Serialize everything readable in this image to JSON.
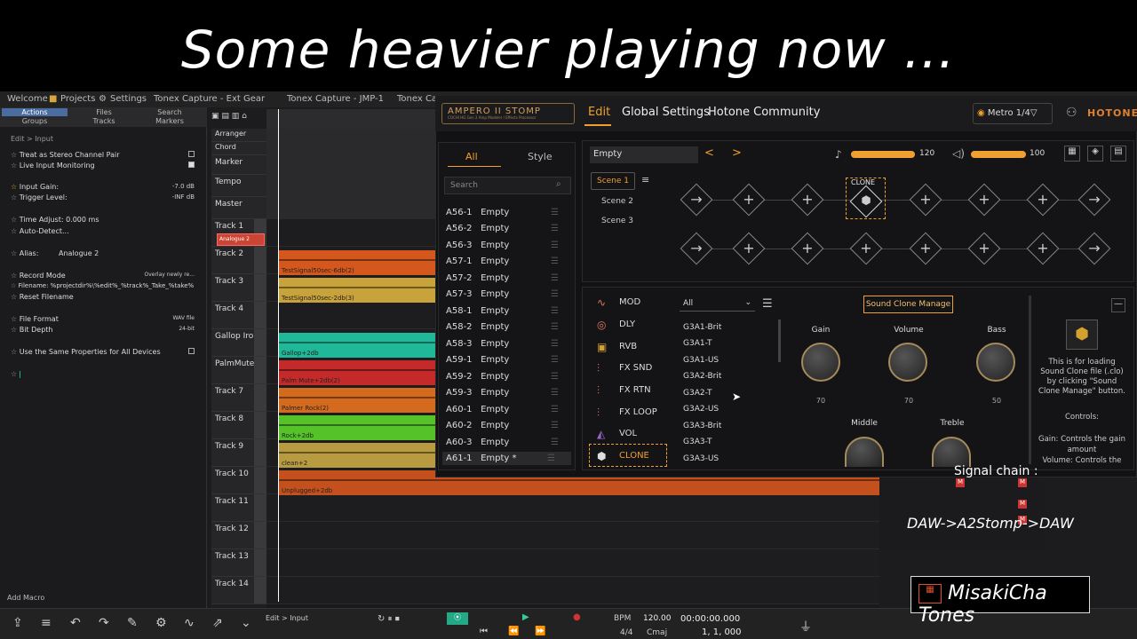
{
  "caption": "Some heavier playing now …",
  "tabs": [
    "Welcome",
    "Projects",
    "Settings",
    "Tonex Capture - Ext Gear",
    "Tonex Capture - JMP-1",
    "Tonex Cap"
  ],
  "leftpanel": {
    "tabs_row1": [
      "Actions",
      "Files",
      "Search"
    ],
    "tabs_row2": [
      "Groups",
      "Tracks",
      "Markers"
    ],
    "breadcrumb": "Edit  >  Input",
    "rows": [
      {
        "label": "Treat as Stereo Channel Pair",
        "value": ""
      },
      {
        "label": "Live Input Monitoring",
        "value": ""
      },
      {
        "label": "Input Gain:",
        "value": "-7.0 dB"
      },
      {
        "label": "Trigger Level:",
        "value": "-INF dB"
      },
      {
        "label": "Time Adjust:  0.000 ms",
        "value": ""
      },
      {
        "label": "Auto-Detect...",
        "value": ""
      },
      {
        "label": "Alias:",
        "value": "Analogue 2"
      },
      {
        "label": "Record Mode",
        "value": "Overlay newly re..."
      },
      {
        "label": "Filename:  %projectdir%\\%edit%_%track%_Take_%take%",
        "value": ""
      },
      {
        "label": "Reset Filename",
        "value": ""
      },
      {
        "label": "File Format",
        "value": "WAV file"
      },
      {
        "label": "Bit Depth",
        "value": "24-bit"
      },
      {
        "label": "Use the Same Properties for All Devices",
        "value": ""
      }
    ],
    "add_macro": "Add Macro"
  },
  "tracks": [
    "Arranger",
    "Chord",
    "Marker",
    "Tempo",
    "Master",
    "Track 1",
    "Track 2",
    "Track 3",
    "Track 4",
    "Gallop Iron",
    "PalmMute",
    "Track 7",
    "Track 8",
    "Track 9",
    "Track 10",
    "Track 11",
    "Track 12",
    "Track 13",
    "Track 14"
  ],
  "clips": [
    {
      "label": "TestSignal50sec-6db(2)",
      "color": "#d4581e"
    },
    {
      "label": "TestSignal50sec-2db(3)",
      "color": "#c8a23a"
    },
    {
      "label": "Gallop+2db",
      "color": "#1fb899"
    },
    {
      "label": "Palm Mute+2db(2)",
      "color": "#c42a2a"
    },
    {
      "label": "Palmer Rock(2)",
      "color": "#d46a1e"
    },
    {
      "label": "Rock+2db",
      "color": "#55c22a"
    },
    {
      "label": "clean+2",
      "color": "#b89a40"
    },
    {
      "label": "Unplugged+2db",
      "color": "#c4501e"
    }
  ],
  "input_label": "Analogue 2",
  "ampero": {
    "logo": "AMPERO II STOMP",
    "logo_sub": "COCHI HG Gen 2 Amp Modeler / Effects Processor",
    "nav": [
      "Edit",
      "Global Settings",
      "Hotone Community"
    ],
    "metro": "Metro 1/4▽",
    "brand": "HOTONE",
    "preset_tabs": [
      "All",
      "Style"
    ],
    "search_placeholder": "Search",
    "presets": [
      {
        "id": "A56-1",
        "name": "Empty"
      },
      {
        "id": "A56-2",
        "name": "Empty"
      },
      {
        "id": "A56-3",
        "name": "Empty"
      },
      {
        "id": "A57-1",
        "name": "Empty"
      },
      {
        "id": "A57-2",
        "name": "Empty"
      },
      {
        "id": "A57-3",
        "name": "Empty"
      },
      {
        "id": "A58-1",
        "name": "Empty"
      },
      {
        "id": "A58-2",
        "name": "Empty"
      },
      {
        "id": "A58-3",
        "name": "Empty"
      },
      {
        "id": "A59-1",
        "name": "Empty"
      },
      {
        "id": "A59-2",
        "name": "Empty"
      },
      {
        "id": "A59-3",
        "name": "Empty"
      },
      {
        "id": "A60-1",
        "name": "Empty"
      },
      {
        "id": "A60-2",
        "name": "Empty"
      },
      {
        "id": "A60-3",
        "name": "Empty"
      },
      {
        "id": "A61-1",
        "name": "Empty *"
      }
    ],
    "preset_name": "Empty",
    "tempo": "120",
    "volume": "100",
    "scenes": [
      "Scene 1",
      "Scene 2",
      "Scene 3"
    ],
    "clone_label": "CLONE",
    "categories": [
      "MOD",
      "DLY",
      "RVB",
      "FX SND",
      "FX RTN",
      "FX LOOP",
      "VOL",
      "CLONE"
    ],
    "filter": "All",
    "models": [
      "G3A1-Brit",
      "G3A1-T",
      "G3A1-US",
      "G3A2-Brit",
      "G3A2-T",
      "G3A2-US",
      "G3A3-Brit",
      "G3A3-T",
      "G3A3-US"
    ],
    "sound_clone_button": "Sound Clone Manage",
    "knobs": [
      {
        "label": "Gain",
        "value": "70"
      },
      {
        "label": "Volume",
        "value": "70"
      },
      {
        "label": "Bass",
        "value": "50"
      },
      {
        "label": "Middle",
        "value": ""
      },
      {
        "label": "Treble",
        "value": ""
      }
    ],
    "help_text": "This is for loading Sound Clone file (.clo) by clicking \"Sound Clone Manage\" button.",
    "controls_title": "Controls:",
    "controls_text": "Gain: Controls the gain amount\nVolume: Controls the"
  },
  "signal_chain_label": "Signal chain :",
  "signal_chain": "DAW->A2Stomp->DAW",
  "channel_brand": "MisakiCha Tones",
  "transport": {
    "bpm_label": "BPM",
    "bpm": "120.00",
    "timecode": "00:00:00.000",
    "sig": "4/4",
    "key": "Cmaj",
    "bars": "1, 1, 000",
    "edit_crumb": "Edit  >  Input"
  }
}
